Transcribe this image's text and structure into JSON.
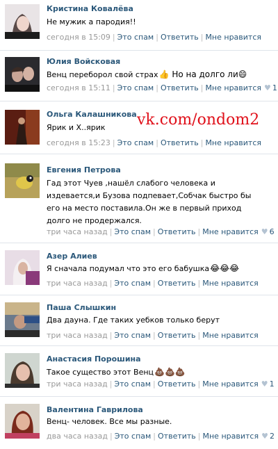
{
  "watermark": "vk.com/ondom2",
  "labels": {
    "spam": "Это спам",
    "reply": "Ответить",
    "like": "Мне нравится"
  },
  "comments": [
    {
      "author": "Кристина Ковалёва",
      "text": "Не мужик а пародия!!",
      "emoji": "",
      "time": "сегодня в 15:09",
      "likes": ""
    },
    {
      "author": "Юлия Войсковая",
      "text": "Венц переборол свой страх",
      "emoji": "👍 Но на долго ли😄",
      "time": "сегодня в 15:11",
      "likes": "1"
    },
    {
      "author": "Ольга Калашникова",
      "text": "Ярик и Х..ярик",
      "emoji": "",
      "time": "сегодня в 15:23",
      "likes": ""
    },
    {
      "author": "Евгения Петрова",
      "text": "Гад этот Чуев ,нашёл слабого человека и издевается,и Бузова подпевает,Собчак быстро бы его на место поставила.Он же в первый приход долго не продержался.",
      "emoji": "",
      "time": "три часа назад",
      "likes": "6"
    },
    {
      "author": "Азер Алиев",
      "text": "Я сначала подумал что это его бабушка",
      "emoji": "😂😂😂",
      "time": "три часа назад",
      "likes": ""
    },
    {
      "author": "Паша Слышкин",
      "text": "Два дауна. Где таких уебков только берут",
      "emoji": "",
      "time": "три часа назад",
      "likes": ""
    },
    {
      "author": "Анастасия Порошина",
      "text": "Такое существо этот Венц",
      "emoji": "💩💩💩",
      "time": "три часа назад",
      "likes": "1"
    },
    {
      "author": "Валентина Гаврилова",
      "text": "Венц- человек. Все мы разные.",
      "emoji": "",
      "time": "два часа назад",
      "likes": "2"
    }
  ]
}
